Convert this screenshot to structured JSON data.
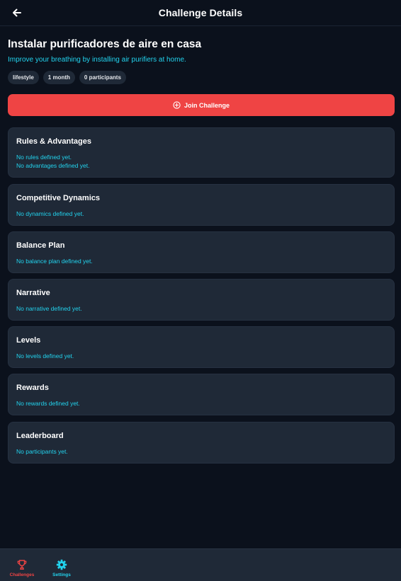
{
  "header": {
    "title": "Challenge Details",
    "back_icon": "arrow-left-icon"
  },
  "challenge": {
    "title": "Instalar purificadores de aire en casa",
    "description": "Improve your breathing by installing air purifiers at home.",
    "tags": [
      "lifestyle",
      "1 month",
      "0 participants"
    ]
  },
  "join_button": {
    "label": "Join Challenge",
    "icon": "plus-circle-icon",
    "color": "#ef4444"
  },
  "sections": [
    {
      "title": "Rules & Advantages",
      "lines": [
        "No rules defined yet.",
        "No advantages defined yet."
      ]
    },
    {
      "title": "Competitive Dynamics",
      "lines": [
        "No dynamics defined yet."
      ]
    },
    {
      "title": "Balance Plan",
      "lines": [
        "No balance plan defined yet."
      ]
    },
    {
      "title": "Narrative",
      "lines": [
        "No narrative defined yet."
      ]
    },
    {
      "title": "Levels",
      "lines": [
        "No levels defined yet."
      ]
    },
    {
      "title": "Rewards",
      "lines": [
        "No rewards defined yet."
      ]
    },
    {
      "title": "Leaderboard",
      "lines": [
        "No participants yet."
      ]
    }
  ],
  "bottom_nav": {
    "items": [
      {
        "label": "Challenges",
        "icon": "trophy-icon",
        "active": true,
        "color": "#ef4444"
      },
      {
        "label": "Settings",
        "icon": "gear-icon",
        "active": false,
        "color": "#22d3ee"
      }
    ]
  },
  "colors": {
    "background": "#0b111c",
    "card": "#1f2937",
    "accent_cyan": "#22d3ee",
    "accent_red": "#ef4444"
  }
}
